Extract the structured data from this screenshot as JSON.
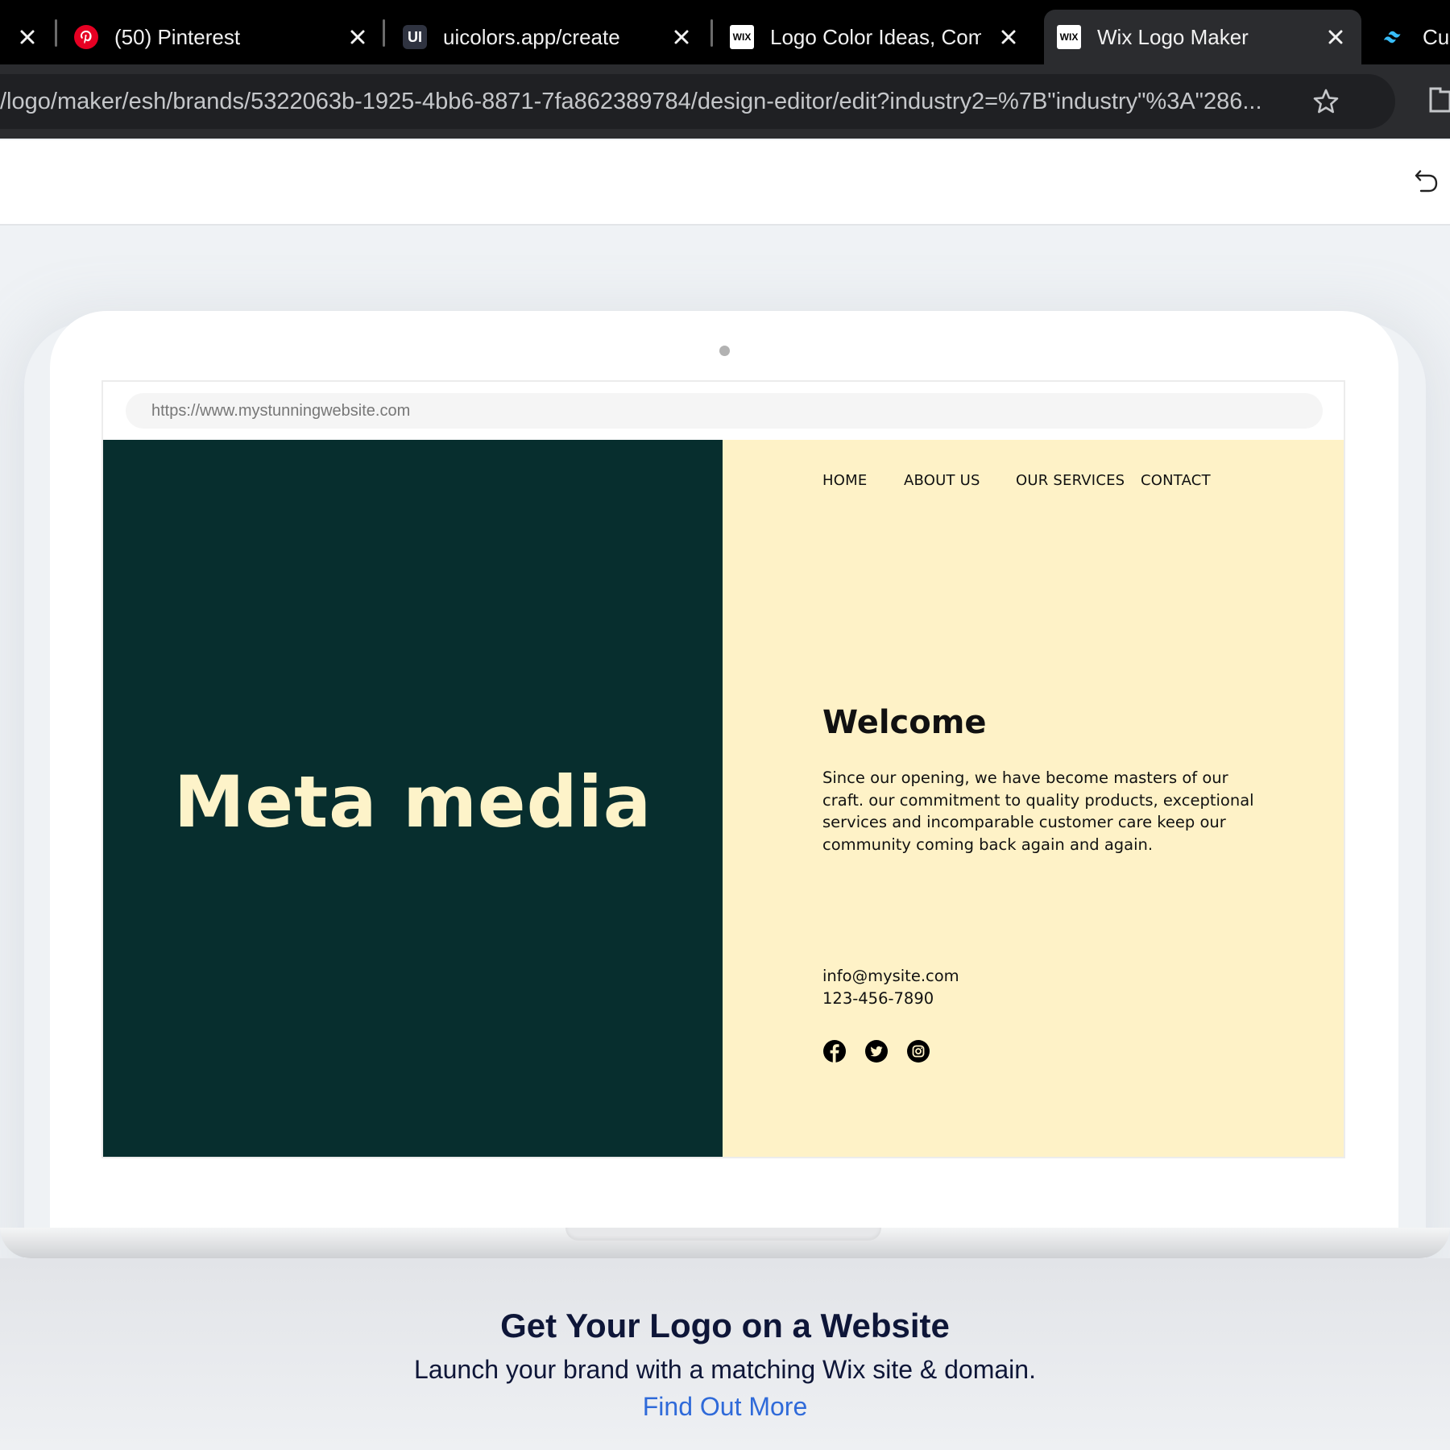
{
  "browser": {
    "tabs": [
      {
        "title": "(50) Pinterest",
        "favicon": "pinterest-icon",
        "active": false
      },
      {
        "title": "uicolors.app/create",
        "favicon": "uicolors-icon",
        "favicon_text": "UI",
        "active": false
      },
      {
        "title": "Logo Color Ideas, Com",
        "favicon": "wix-icon",
        "favicon_text": "WIX",
        "active": false
      },
      {
        "title": "Wix Logo Maker",
        "favicon": "wix-icon",
        "favicon_text": "WIX",
        "active": true
      },
      {
        "title": "Cus",
        "favicon": "tailwind-icon",
        "active": false
      }
    ],
    "url": "/logo/maker/esh/brands/5322063b-1925-4bb6-8871-7fa862389784/design-editor/edit?industry2=%7B\"industry\"%3A\"286..."
  },
  "mock_site": {
    "url": "https://www.mystunningwebsite.com",
    "brand_name": "Meta media",
    "nav": [
      "HOME",
      "ABOUT US",
      "OUR SERVICES",
      "CONTACT"
    ],
    "welcome_title": "Welcome",
    "welcome_text": "Since our opening, we have become masters of our craft. our commitment to quality products, exceptional services and incomparable customer care keep our community coming back again and again.",
    "email": "info@mysite.com",
    "phone": "123-456-7890",
    "social_icons": [
      "facebook-icon",
      "twitter-icon",
      "instagram-icon"
    ],
    "colors": {
      "left_panel": "#072e2e",
      "right_panel": "#fef2c7",
      "brand_text": "#fdf3c9"
    }
  },
  "cta": {
    "title": "Get Your Logo on a Website",
    "subtitle": "Launch your brand with a matching Wix site & domain.",
    "link": "Find Out More",
    "link_color": "#2f6ad9"
  }
}
